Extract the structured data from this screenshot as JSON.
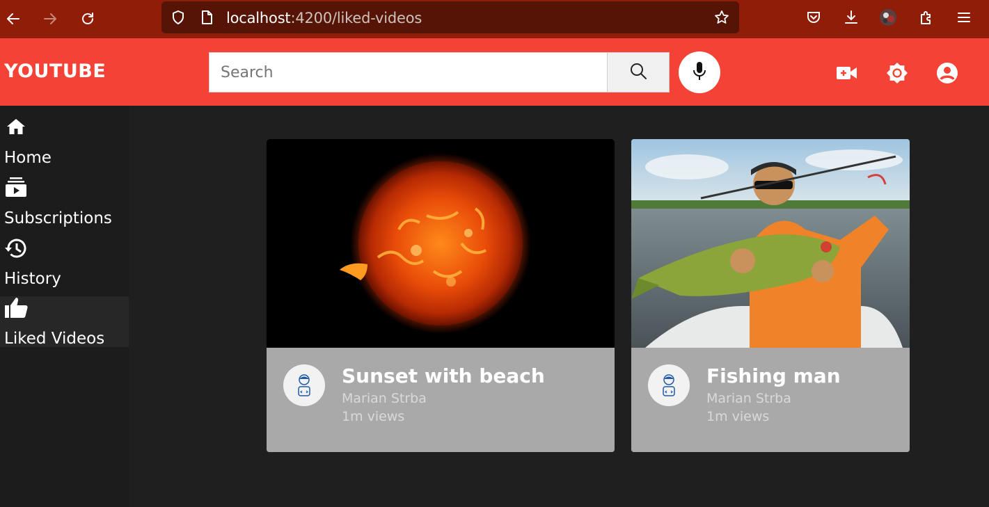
{
  "browser": {
    "url_host": "localhost",
    "url_path": ":4200/liked-videos",
    "icons": [
      "back-icon",
      "forward-icon",
      "reload-icon",
      "shield-icon",
      "page-icon",
      "star-icon",
      "pocket-icon",
      "download-icon",
      "profile-avatar",
      "extensions-icon",
      "menu-icon"
    ]
  },
  "header": {
    "logo": "YOUTUBE",
    "search_placeholder": "Search",
    "icons": [
      "search-icon",
      "mic-icon",
      "video-add-icon",
      "brightness-icon",
      "account-icon"
    ],
    "color": "#f44336"
  },
  "sidebar": {
    "items": [
      {
        "label": "Home",
        "icon": "home-icon",
        "active": false
      },
      {
        "label": "Subscriptions",
        "icon": "subscriptions-icon",
        "active": false
      },
      {
        "label": "History",
        "icon": "history-icon",
        "active": false
      },
      {
        "label": "Liked Videos",
        "icon": "thumb-up-icon",
        "active": true
      }
    ]
  },
  "videos": [
    {
      "title": "Sunset with beach",
      "channel": "Marian Strba",
      "views": "1m views",
      "thumbnail": "sun-image"
    },
    {
      "title": "Fishing man",
      "channel": "Marian Strba",
      "views": "1m views",
      "thumbnail": "fishing-image"
    }
  ]
}
